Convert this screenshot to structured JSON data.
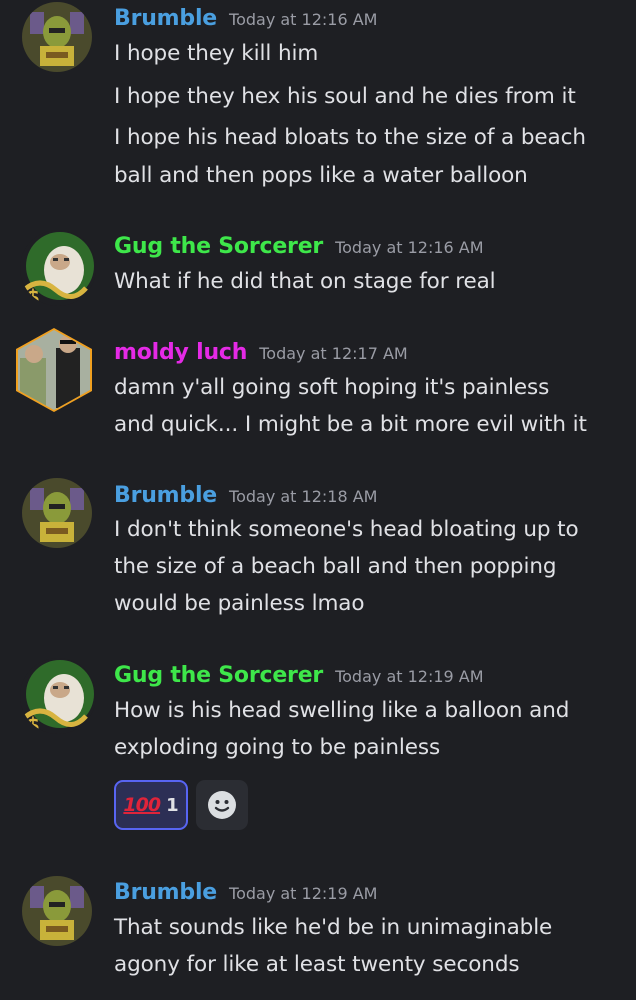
{
  "colors": {
    "background": "#1e1f23",
    "brumble": "#4a9fe0",
    "gug": "#3ee74a",
    "moldy": "#e52ae6",
    "timestamp": "#9a9ca5",
    "text": "#e0e1e5",
    "reaction_border": "#5865f2"
  },
  "messages": [
    {
      "username": "Brumble",
      "timestamp": "Today at 12:16 AM",
      "lines": [
        "I hope they kill him",
        "I hope they hex his soul and he dies from it",
        "I hope his head bloats to the size of a beach",
        "ball and then pops like a water balloon"
      ]
    },
    {
      "username": "Gug the Sorcerer",
      "timestamp": "Today at 12:16 AM",
      "lines": [
        "What if he did that on stage for real"
      ]
    },
    {
      "username": "moldy luch",
      "timestamp": "Today at 12:17 AM",
      "lines": [
        "damn y'all going soft hoping it's painless",
        "and quick... I might be a bit more evil with it"
      ]
    },
    {
      "username": "Brumble",
      "timestamp": "Today at 12:18 AM",
      "lines": [
        "I don't think someone's head bloating up to",
        "the size of a beach ball and then popping",
        "would be painless lmao"
      ]
    },
    {
      "username": "Gug the Sorcerer",
      "timestamp": "Today at 12:19 AM",
      "lines": [
        "How is his head swelling like a balloon and",
        "exploding going to be painless"
      ],
      "reactions": [
        {
          "emoji_text": "100",
          "icon": "hundred-points-emoji",
          "count": "1"
        },
        {
          "icon": "add-reaction-smiley-icon"
        }
      ]
    },
    {
      "username": "Brumble",
      "timestamp": "Today at 12:19 AM",
      "lines": [
        "That sounds like he'd be in unimaginable",
        "agony for like at least twenty seconds"
      ]
    }
  ]
}
